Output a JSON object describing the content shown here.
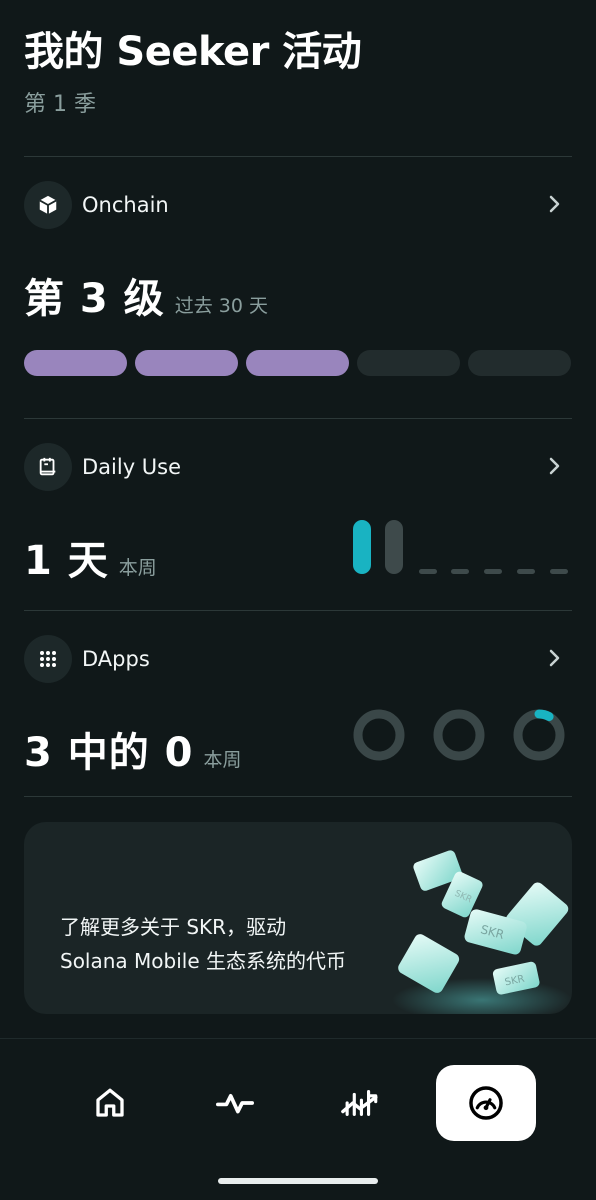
{
  "header": {
    "title": "我的 Seeker 活动",
    "season": "第 1 季"
  },
  "onchain": {
    "label": "Onchain",
    "icon": "cube-icon",
    "level_text": "第 3 级",
    "period": "过去 30 天",
    "level": 3,
    "max_level": 5,
    "accent": "#9985bd"
  },
  "daily_use": {
    "label": "Daily Use",
    "icon": "calendar-icon",
    "value_text": "1 天",
    "period": "本周",
    "days_active": [
      1,
      0,
      0,
      0,
      0,
      0,
      0
    ],
    "accent": "#19b3c2"
  },
  "dapps": {
    "label": "DApps",
    "icon": "grid-dots-icon",
    "value_text": "3 中的 0",
    "period": "本周",
    "ring_progress": [
      0,
      0,
      0.08
    ]
  },
  "banner": {
    "line1": "了解更多关于 SKR，驱动",
    "line2": "Solana Mobile 生态系统的代币",
    "token_label": "SKR"
  },
  "nav": {
    "items": [
      {
        "name": "home",
        "icon": "home-icon"
      },
      {
        "name": "activity",
        "icon": "pulse-icon"
      },
      {
        "name": "stats",
        "icon": "chart-trend-icon"
      },
      {
        "name": "dashboard",
        "icon": "gauge-icon",
        "active": true
      }
    ]
  }
}
